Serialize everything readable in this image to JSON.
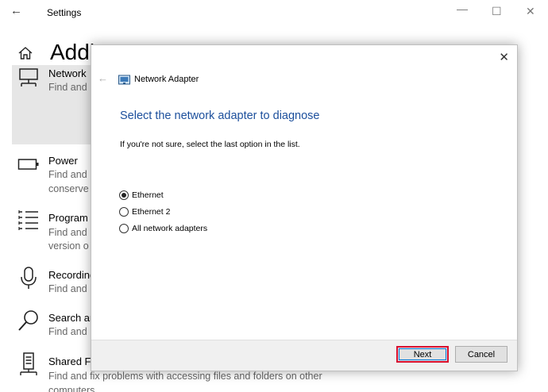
{
  "titlebar": {
    "title": "Settings",
    "back_icon": "←",
    "min_icon": "—",
    "max_icon": "☐",
    "close_icon": "✕"
  },
  "page": {
    "title": "Addi"
  },
  "items": [
    {
      "title": "Network",
      "desc": "Find and"
    },
    {
      "title": "Power",
      "desc1": "Find and",
      "desc2": "conserve"
    },
    {
      "title": "Program",
      "desc1": "Find and",
      "desc2": "version o"
    },
    {
      "title": "Recording",
      "desc": "Find and"
    },
    {
      "title": "Search ar",
      "desc": "Find and"
    },
    {
      "title": "Shared Fo",
      "desc1": "Find and fix problems with accessing files and folders on other",
      "desc2": "computers"
    }
  ],
  "dialog": {
    "close_icon": "✕",
    "back_icon": "←",
    "app_title": "Network Adapter",
    "heading": "Select the network adapter to diagnose",
    "hint": "If you're not sure, select the last option in the list.",
    "options": [
      {
        "label": "Ethernet",
        "checked": true
      },
      {
        "label": "Ethernet 2",
        "checked": false
      },
      {
        "label": "All network adapters",
        "checked": false
      }
    ],
    "next_label": "Next",
    "cancel_label": "Cancel"
  },
  "colors": {
    "heading": "#1c4f9c",
    "highlight": "#d8102f"
  }
}
